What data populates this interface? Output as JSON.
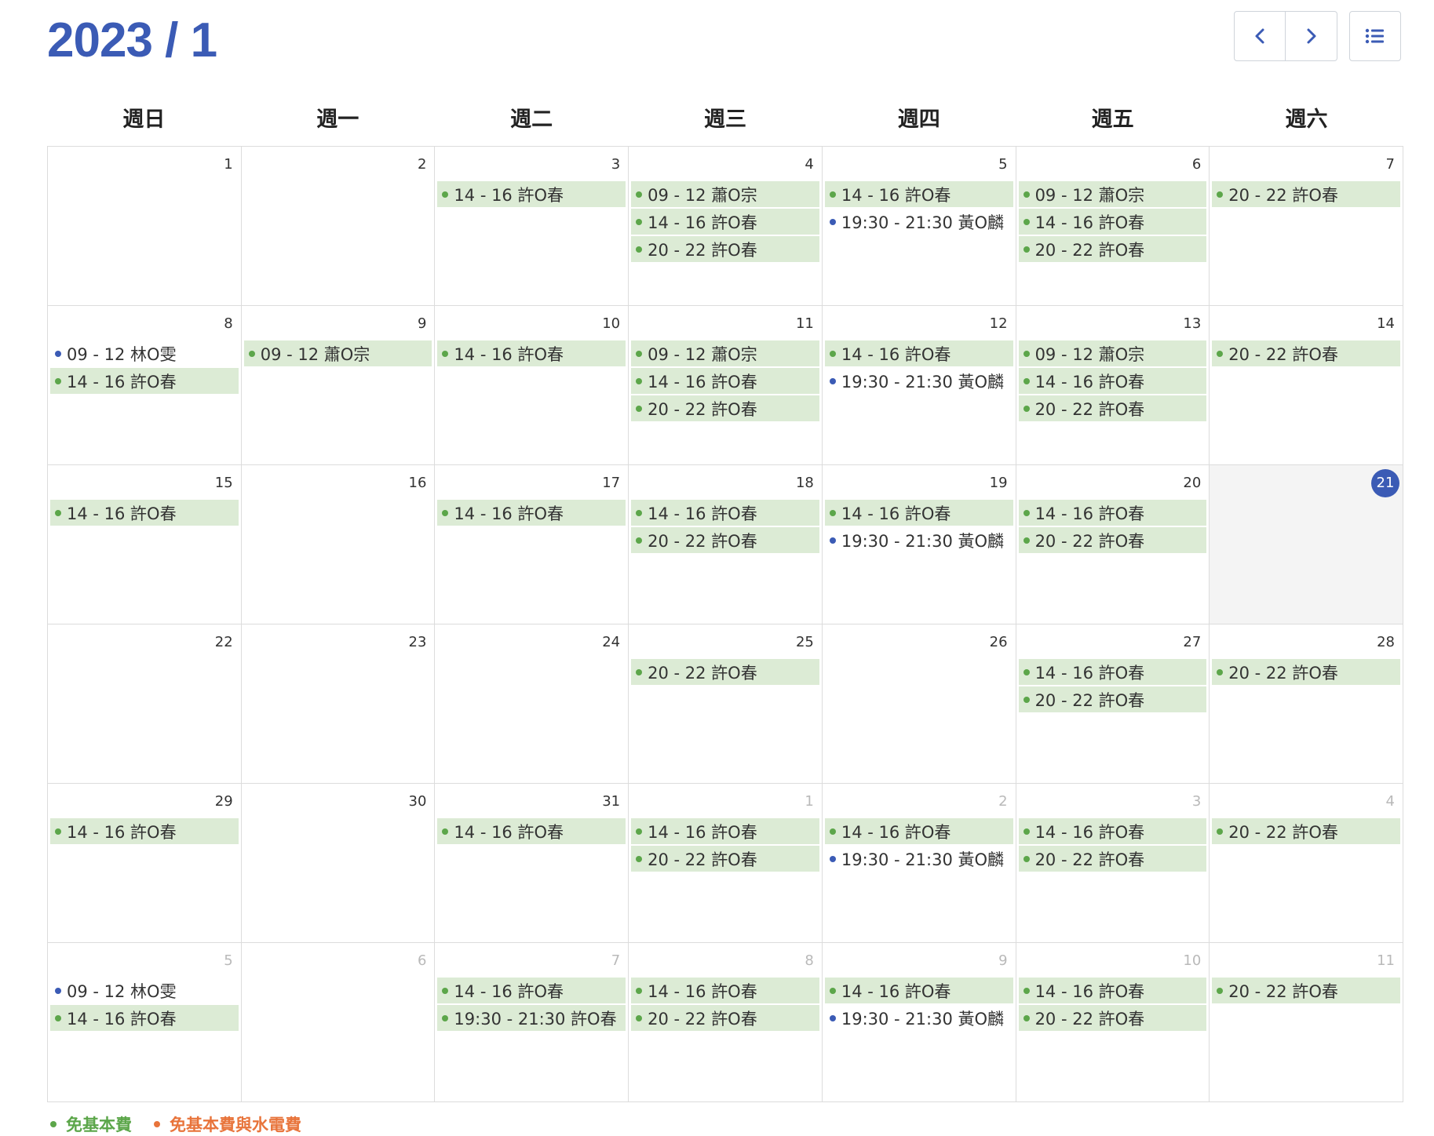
{
  "header": {
    "title": "2023 / 1",
    "prev_icon": "chevron-left-icon",
    "next_icon": "chevron-right-icon",
    "list_icon": "list-icon"
  },
  "colors": {
    "accent": "#3b5bb5",
    "event_bg": "#dcebd5",
    "green": "#5ca64a",
    "blue": "#3b5bb5",
    "orange": "#e8743b"
  },
  "weekdays": [
    "週日",
    "週一",
    "週二",
    "週三",
    "週四",
    "週五",
    "週六"
  ],
  "weeks": [
    [
      {
        "day": "1",
        "events": []
      },
      {
        "day": "2",
        "events": []
      },
      {
        "day": "3",
        "events": [
          {
            "text": "14 - 16 許O春",
            "style": "green"
          }
        ]
      },
      {
        "day": "4",
        "events": [
          {
            "text": "09 - 12 蕭O宗",
            "style": "green"
          },
          {
            "text": "14 - 16 許O春",
            "style": "green"
          },
          {
            "text": "20 - 22 許O春",
            "style": "green"
          }
        ]
      },
      {
        "day": "5",
        "events": [
          {
            "text": "14 - 16 許O春",
            "style": "green"
          },
          {
            "text": "19:30 - 21:30 黃O麟",
            "style": "blue"
          }
        ]
      },
      {
        "day": "6",
        "events": [
          {
            "text": "09 - 12 蕭O宗",
            "style": "green"
          },
          {
            "text": "14 - 16 許O春",
            "style": "green"
          },
          {
            "text": "20 - 22 許O春",
            "style": "green"
          }
        ]
      },
      {
        "day": "7",
        "events": [
          {
            "text": "20 - 22 許O春",
            "style": "green"
          }
        ]
      }
    ],
    [
      {
        "day": "8",
        "events": [
          {
            "text": "09 - 12 林O雯",
            "style": "blue"
          },
          {
            "text": "14 - 16 許O春",
            "style": "green"
          }
        ]
      },
      {
        "day": "9",
        "events": [
          {
            "text": "09 - 12 蕭O宗",
            "style": "green"
          }
        ]
      },
      {
        "day": "10",
        "events": [
          {
            "text": "14 - 16 許O春",
            "style": "green"
          }
        ]
      },
      {
        "day": "11",
        "events": [
          {
            "text": "09 - 12 蕭O宗",
            "style": "green"
          },
          {
            "text": "14 - 16 許O春",
            "style": "green"
          },
          {
            "text": "20 - 22 許O春",
            "style": "green"
          }
        ]
      },
      {
        "day": "12",
        "events": [
          {
            "text": "14 - 16 許O春",
            "style": "green"
          },
          {
            "text": "19:30 - 21:30 黃O麟",
            "style": "blue"
          }
        ]
      },
      {
        "day": "13",
        "events": [
          {
            "text": "09 - 12 蕭O宗",
            "style": "green"
          },
          {
            "text": "14 - 16 許O春",
            "style": "green"
          },
          {
            "text": "20 - 22 許O春",
            "style": "green"
          }
        ]
      },
      {
        "day": "14",
        "events": [
          {
            "text": "20 - 22 許O春",
            "style": "green"
          }
        ]
      }
    ],
    [
      {
        "day": "15",
        "events": [
          {
            "text": "14 - 16 許O春",
            "style": "green"
          }
        ]
      },
      {
        "day": "16",
        "events": []
      },
      {
        "day": "17",
        "events": [
          {
            "text": "14 - 16 許O春",
            "style": "green"
          }
        ]
      },
      {
        "day": "18",
        "events": [
          {
            "text": "14 - 16 許O春",
            "style": "green"
          },
          {
            "text": "20 - 22 許O春",
            "style": "green"
          }
        ]
      },
      {
        "day": "19",
        "events": [
          {
            "text": "14 - 16 許O春",
            "style": "green"
          },
          {
            "text": "19:30 - 21:30 黃O麟",
            "style": "blue"
          }
        ]
      },
      {
        "day": "20",
        "events": [
          {
            "text": "14 - 16 許O春",
            "style": "green"
          },
          {
            "text": "20 - 22 許O春",
            "style": "green"
          }
        ]
      },
      {
        "day": "21",
        "today": true,
        "events": []
      }
    ],
    [
      {
        "day": "22",
        "events": []
      },
      {
        "day": "23",
        "events": []
      },
      {
        "day": "24",
        "events": []
      },
      {
        "day": "25",
        "events": [
          {
            "text": "20 - 22 許O春",
            "style": "green"
          }
        ]
      },
      {
        "day": "26",
        "events": []
      },
      {
        "day": "27",
        "events": [
          {
            "text": "14 - 16 許O春",
            "style": "green"
          },
          {
            "text": "20 - 22 許O春",
            "style": "green"
          }
        ]
      },
      {
        "day": "28",
        "events": [
          {
            "text": "20 - 22 許O春",
            "style": "green"
          }
        ]
      }
    ],
    [
      {
        "day": "29",
        "events": [
          {
            "text": "14 - 16 許O春",
            "style": "green"
          }
        ]
      },
      {
        "day": "30",
        "events": []
      },
      {
        "day": "31",
        "events": [
          {
            "text": "14 - 16 許O春",
            "style": "green"
          }
        ]
      },
      {
        "day": "1",
        "other": true,
        "events": [
          {
            "text": "14 - 16 許O春",
            "style": "green"
          },
          {
            "text": "20 - 22 許O春",
            "style": "green"
          }
        ]
      },
      {
        "day": "2",
        "other": true,
        "events": [
          {
            "text": "14 - 16 許O春",
            "style": "green"
          },
          {
            "text": "19:30 - 21:30 黃O麟",
            "style": "blue"
          }
        ]
      },
      {
        "day": "3",
        "other": true,
        "events": [
          {
            "text": "14 - 16 許O春",
            "style": "green"
          },
          {
            "text": "20 - 22 許O春",
            "style": "green"
          }
        ]
      },
      {
        "day": "4",
        "other": true,
        "events": [
          {
            "text": "20 - 22 許O春",
            "style": "green"
          }
        ]
      }
    ],
    [
      {
        "day": "5",
        "other": true,
        "events": [
          {
            "text": "09 - 12 林O雯",
            "style": "blue"
          },
          {
            "text": "14 - 16 許O春",
            "style": "green"
          }
        ]
      },
      {
        "day": "6",
        "other": true,
        "events": []
      },
      {
        "day": "7",
        "other": true,
        "events": [
          {
            "text": "14 - 16 許O春",
            "style": "green"
          },
          {
            "text": "19:30 - 21:30 許O春",
            "style": "green"
          }
        ]
      },
      {
        "day": "8",
        "other": true,
        "events": [
          {
            "text": "14 - 16 許O春",
            "style": "green"
          },
          {
            "text": "20 - 22 許O春",
            "style": "green"
          }
        ]
      },
      {
        "day": "9",
        "other": true,
        "events": [
          {
            "text": "14 - 16 許O春",
            "style": "green"
          },
          {
            "text": "19:30 - 21:30 黃O麟",
            "style": "blue"
          }
        ]
      },
      {
        "day": "10",
        "other": true,
        "events": [
          {
            "text": "14 - 16 許O春",
            "style": "green"
          },
          {
            "text": "20 - 22 許O春",
            "style": "green"
          }
        ]
      },
      {
        "day": "11",
        "other": true,
        "events": [
          {
            "text": "20 - 22 許O春",
            "style": "green"
          }
        ]
      }
    ]
  ],
  "legend": [
    {
      "label": "免基本費",
      "color": "#5ca64a"
    },
    {
      "label": "免基本費與水電費",
      "color": "#e8743b"
    }
  ]
}
